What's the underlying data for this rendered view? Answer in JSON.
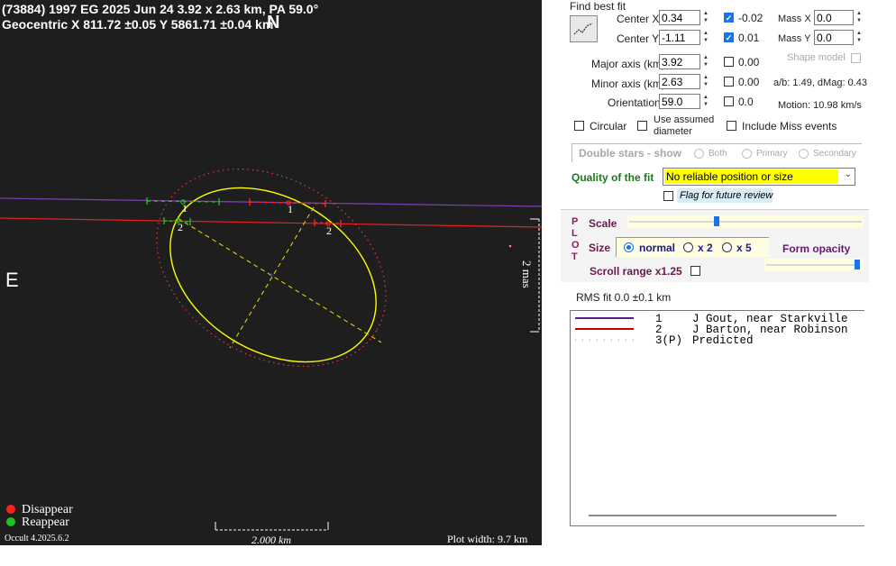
{
  "plot": {
    "header_line1": "(73884) 1997 EG  2025 Jun 24  3.92 x 2.63 km, PA 59.0°",
    "header_line2": "Geocentric  X  811.72 ±0.05  Y 5861.71 ±0.04 km",
    "north": "N",
    "east": "E",
    "scale_label_vertical": "2 mas",
    "chord_labels": [
      "1",
      "1",
      "2",
      "2"
    ],
    "legend_disappear": "Disappear",
    "legend_reappear": "Reappear",
    "version": "Occult 4.2025.6.2",
    "scalebar_label": "2.000 km",
    "plot_width": "Plot width: 9.7 km",
    "colors": {
      "fit": "#ffff00",
      "predicted": "#ff3030",
      "chord1": "#7030a0",
      "chord2": "#ff2020",
      "reappear": "#20c020",
      "disappear": "#ff2020"
    }
  },
  "panel": {
    "find_best_fit": "Find best fit",
    "center_x_label": "Center X",
    "center_x_value": "0.34",
    "center_x_step": "-0.02",
    "mass_x_label": "Mass X",
    "mass_x_value": "0.0",
    "center_y_label": "Center Y",
    "center_y_value": "-1.11",
    "center_y_step": "0.01",
    "mass_y_label": "Mass Y",
    "mass_y_value": "0.0",
    "major_label": "Major axis (km)",
    "major_value": "3.92",
    "major_step": "0.00",
    "shape_model": "Shape model",
    "minor_label": "Minor axis (km)",
    "minor_value": "2.63",
    "minor_step": "0.00",
    "ab_dmag": "a/b: 1.49, dMag: 0.43",
    "orient_label": "Orientation",
    "orient_value": "59.0",
    "orient_step": "0.0",
    "motion": "Motion: 10.98 km/s",
    "circular": "Circular",
    "use_assumed_1": "Use assumed",
    "use_assumed_2": "diameter",
    "include_miss": "Include Miss events",
    "double_stars": "Double stars - show",
    "both": "Both",
    "primary": "Primary",
    "secondary": "Secondary",
    "quality_label": "Quality of the fit",
    "quality_value": "No reliable position or size",
    "flag_label": "Flag for future review",
    "plot_letters": [
      "P",
      "L",
      "O",
      "T"
    ],
    "scale_label": "Scale",
    "size_label": "Size",
    "size_normal": "normal",
    "size_x2": "x 2",
    "size_x5": "x 5",
    "form_opacity": "Form opacity",
    "scroll_range": "Scroll range x1.25",
    "rms_fit": "RMS fit 0.0 ±0.1 km",
    "legend": [
      {
        "num": "1",
        "text": "J Gout, near Starkville",
        "color": "#5b1f7a"
      },
      {
        "num": "2",
        "text": "J Barton, near Robinson",
        "color": "#c00000"
      },
      {
        "num": "3(P)",
        "text": "Predicted",
        "color": "#e06060"
      }
    ]
  }
}
